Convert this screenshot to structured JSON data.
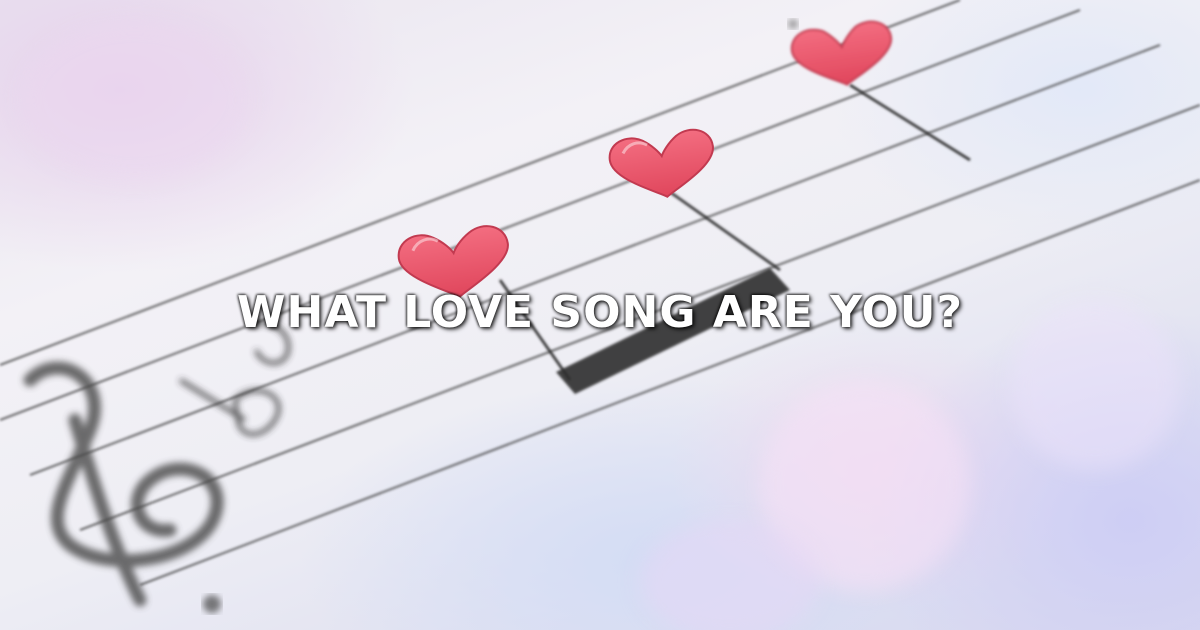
{
  "image": {
    "headline": "WHAT LOVE SONG ARE YOU?",
    "colors": {
      "heart_fill": "#ef5a6e",
      "heart_shadow": "#d23e55",
      "staff_line": "#3a3a3a",
      "headline_text": "#ffffff",
      "background_tint": "#e4e2f2"
    },
    "icons": {
      "clef": "treble-clef-icon",
      "note_hearts": "heart-icon"
    }
  }
}
